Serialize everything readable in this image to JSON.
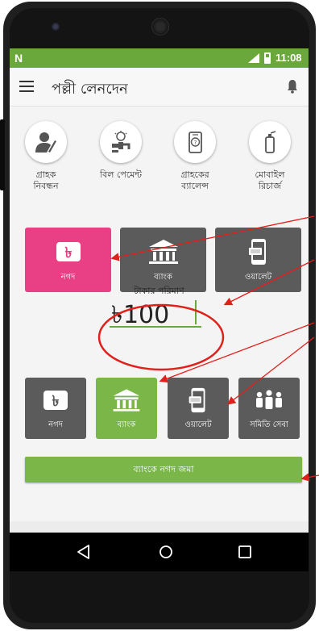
{
  "status_bar": {
    "carrier_icon": "N",
    "time": "11:08"
  },
  "app_bar": {
    "title": "পল্লী লেনদেন",
    "menu_icon": "hamburger-icon",
    "bell_icon": "bell-icon"
  },
  "services": [
    {
      "label": "গ্রাহক\nনিবন্ধন",
      "icon": "user-register-icon"
    },
    {
      "label": "বিল পেমেন্ট",
      "icon": "bill-payment-icon"
    },
    {
      "label": "গ্রাহকের\nব্যালেন্স",
      "icon": "balance-phone-icon"
    },
    {
      "label": "মোবাইল\nরিচার্জ",
      "icon": "mobile-recharge-icon"
    }
  ],
  "source_tiles": [
    {
      "label": "নগদ",
      "icon": "taka-icon",
      "selected": true
    },
    {
      "label": "ব্যাংক",
      "icon": "bank-icon",
      "selected": false
    },
    {
      "label": "ওয়ালেট",
      "icon": "wallet-phone-icon",
      "selected": false
    }
  ],
  "amount": {
    "label": "টাকার পরিমাণ",
    "value": "৳100"
  },
  "dest_tiles": [
    {
      "label": "নগদ",
      "icon": "taka-icon",
      "selected": false
    },
    {
      "label": "ব্যাংক",
      "icon": "bank-icon",
      "selected": true
    },
    {
      "label": "ওয়ালেট",
      "icon": "wallet-phone-icon",
      "selected": false
    },
    {
      "label": "সমিতি সেবা",
      "icon": "group-icon",
      "selected": false
    }
  ],
  "submit": {
    "label": "ব্যাংকে নগদ জমা"
  },
  "colors": {
    "primary": "#6aa83b",
    "accent": "#7ab648",
    "selected_source": "#e93f84",
    "tile": "#5b5b5b",
    "annotation": "#e0201a"
  }
}
